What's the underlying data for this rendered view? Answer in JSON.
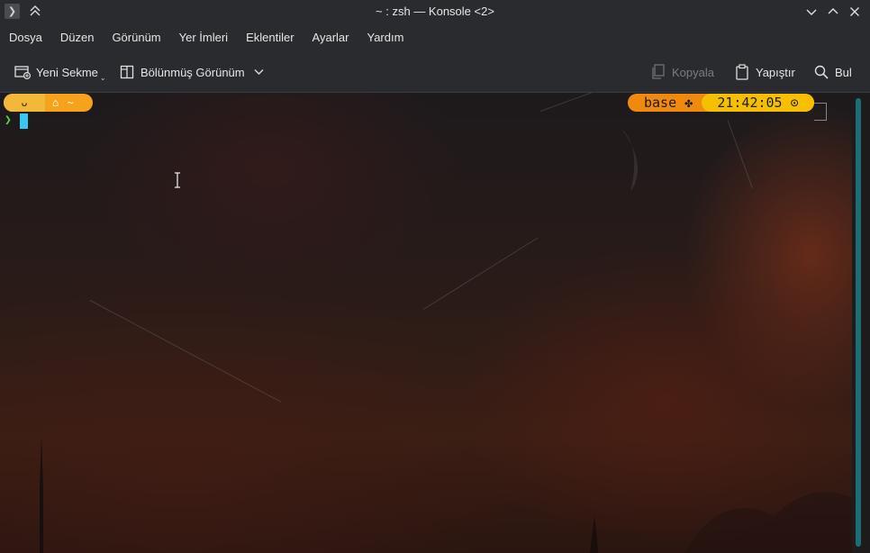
{
  "window": {
    "title": "~ : zsh — Konsole <2>",
    "app_icon": "terminal-icon",
    "buttons": [
      "minimize-icon",
      "maximize-icon",
      "close-icon"
    ]
  },
  "menu": {
    "items": [
      "Dosya",
      "Düzen",
      "Görünüm",
      "Yer İmleri",
      "Eklentiler",
      "Ayarlar",
      "Yardım"
    ]
  },
  "toolbar": {
    "new_tab": "Yeni Sekme",
    "split_view": "Bölünmüş Görünüm",
    "copy": "Kopyala",
    "paste": "Yapıştır",
    "find": "Bul"
  },
  "prompt": {
    "os_glyph": "ᴗ",
    "home_glyph": "⌂",
    "path": "~",
    "env": "base",
    "env_glyph": "✤",
    "time": "21:42:05",
    "clock_glyph": "⊙",
    "symbol": "❯"
  },
  "colors": {
    "accent_orange": "#f08a0c",
    "accent_yellow": "#f6c000",
    "cursor": "#35c8f0",
    "prompt_green": "#5bd34a",
    "scrollbar": "#1f6d74"
  }
}
